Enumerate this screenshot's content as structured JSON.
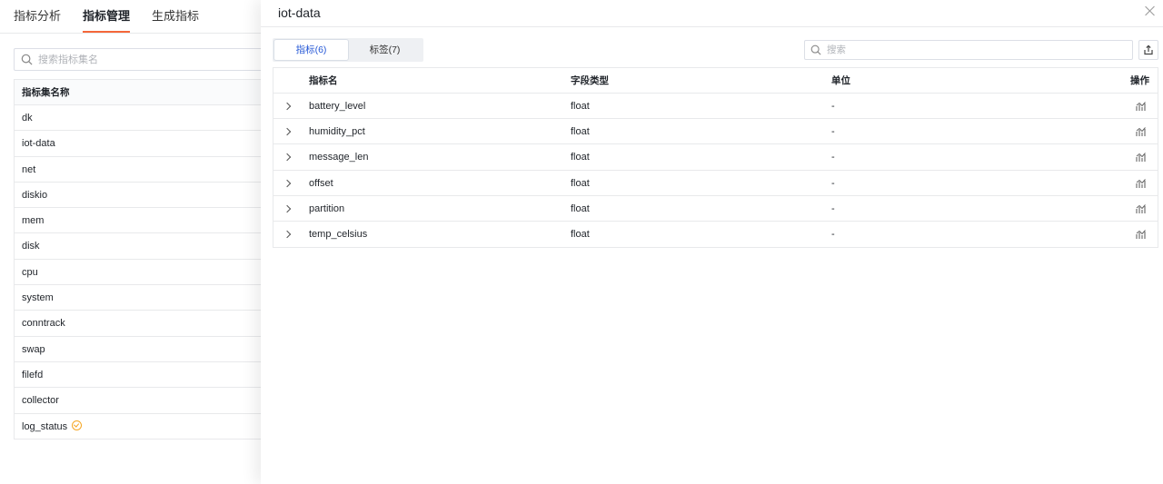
{
  "top_tabs": [
    {
      "label": "指标分析",
      "active": false
    },
    {
      "label": "指标管理",
      "active": true
    },
    {
      "label": "生成指标",
      "active": false
    }
  ],
  "left_panel": {
    "search_placeholder": "搜索指标集名",
    "column_header": "指标集名称",
    "rows": [
      {
        "name": "dk"
      },
      {
        "name": "iot-data"
      },
      {
        "name": "net"
      },
      {
        "name": "diskio"
      },
      {
        "name": "mem"
      },
      {
        "name": "disk"
      },
      {
        "name": "cpu"
      },
      {
        "name": "system"
      },
      {
        "name": "conntrack"
      },
      {
        "name": "swap"
      },
      {
        "name": "filefd"
      },
      {
        "name": "collector"
      },
      {
        "name": "log_status"
      }
    ]
  },
  "drawer": {
    "title": "iot-data",
    "segments": [
      {
        "label": "指标(6)",
        "active": true
      },
      {
        "label": "标签(7)",
        "active": false
      }
    ],
    "search_placeholder": "搜索",
    "columns": {
      "name": "指标名",
      "type": "字段类型",
      "unit": "单位",
      "action": "操作"
    },
    "rows": [
      {
        "name": "battery_level",
        "type": "float",
        "unit": "-"
      },
      {
        "name": "humidity_pct",
        "type": "float",
        "unit": "-"
      },
      {
        "name": "message_len",
        "type": "float",
        "unit": "-"
      },
      {
        "name": "offset",
        "type": "float",
        "unit": "-"
      },
      {
        "name": "partition",
        "type": "float",
        "unit": "-"
      },
      {
        "name": "temp_celsius",
        "type": "float",
        "unit": "-"
      }
    ]
  },
  "colors": {
    "accent": "#f5673a",
    "primary": "#2457d6",
    "badge": "#f5a623"
  },
  "icons": {
    "search": "search-icon",
    "close": "close-icon",
    "export": "export-icon",
    "expand": "chevron-right-icon",
    "analysis": "chart-analysis-icon",
    "status": "status-check-icon"
  }
}
